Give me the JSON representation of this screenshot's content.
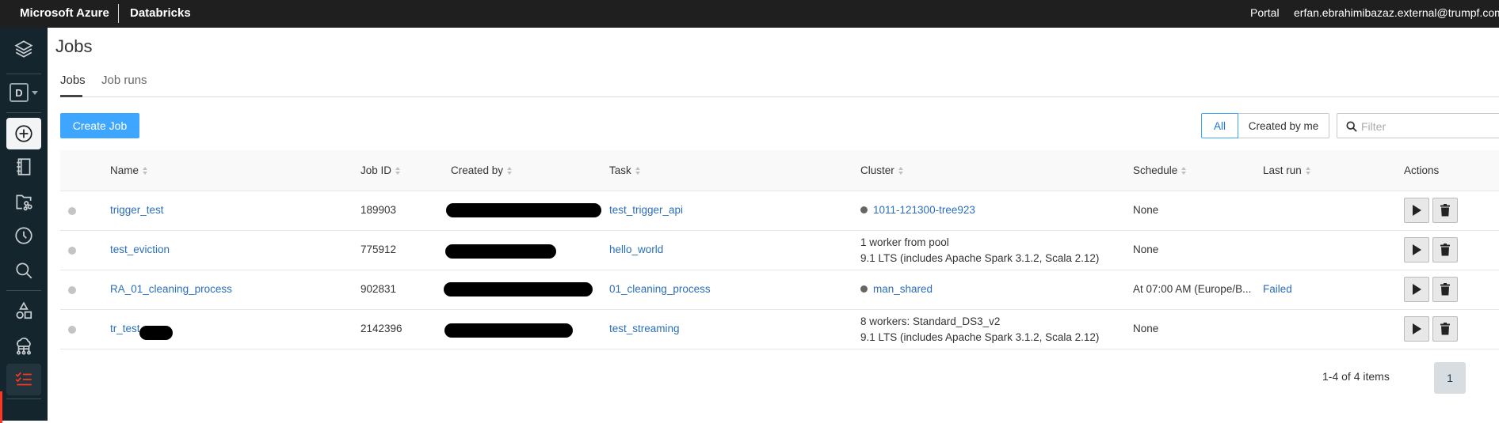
{
  "topbar": {
    "brand": "Microsoft Azure",
    "product": "Databricks",
    "portal": "Portal",
    "user": "erfan.ebrahimibazaz.external@trumpf.com"
  },
  "sidebar": {
    "workspace_letter": "D",
    "items": [
      {
        "name": "databricks-logo",
        "icon": "layers-icon"
      },
      {
        "name": "workspace-switcher",
        "icon": "d-box-icon"
      },
      {
        "name": "create",
        "icon": "plus-circle-icon"
      },
      {
        "name": "workspace",
        "icon": "notebook-icon"
      },
      {
        "name": "repos",
        "icon": "folder-branch-icon"
      },
      {
        "name": "recents",
        "icon": "clock-icon"
      },
      {
        "name": "search",
        "icon": "search-icon"
      },
      {
        "name": "data",
        "icon": "shapes-icon"
      },
      {
        "name": "compute",
        "icon": "cloud-network-icon"
      },
      {
        "name": "jobs",
        "icon": "checklist-icon",
        "active": true
      }
    ],
    "accent": "#ff3621"
  },
  "page": {
    "title": "Jobs",
    "tabs": [
      {
        "label": "Jobs",
        "active": true
      },
      {
        "label": "Job runs",
        "active": false
      }
    ]
  },
  "toolbar": {
    "create_label": "Create Job",
    "filter_all": "All",
    "filter_mine": "Created by me",
    "filter_placeholder": "Filter"
  },
  "table": {
    "columns": [
      "Name",
      "Job ID",
      "Created by",
      "Task",
      "Cluster",
      "Schedule",
      "Last run",
      "Actions"
    ],
    "rows": [
      {
        "name": "trigger_test",
        "job_id": "189903",
        "created_by": "[redacted]",
        "task": "test_trigger_api",
        "cluster_line1": "1011-121300-tree923",
        "cluster_line2": "",
        "cluster_link": true,
        "schedule": "None",
        "last_run": ""
      },
      {
        "name": "test_eviction",
        "job_id": "775912",
        "created_by": "[redacted]",
        "task": "hello_world",
        "cluster_line1": "1 worker from pool",
        "cluster_line2": "9.1 LTS (includes Apache Spark 3.1.2, Scala 2.12)",
        "cluster_link": false,
        "schedule": "None",
        "last_run": ""
      },
      {
        "name": "RA_01_cleaning_process",
        "job_id": "902831",
        "created_by": "[redacted]",
        "task": "01_cleaning_process",
        "cluster_line1": "man_shared",
        "cluster_line2": "",
        "cluster_link": true,
        "schedule": "At 07:00 AM (Europe/B...",
        "last_run": "Failed"
      },
      {
        "name": "tr_test",
        "job_id": "2142396",
        "created_by": "[redacted]",
        "task": "test_streaming",
        "cluster_line1": "8 workers: Standard_DS3_v2",
        "cluster_line2": "9.1 LTS (includes Apache Spark 3.1.2, Scala 2.12)",
        "cluster_link": false,
        "schedule": "None",
        "last_run": ""
      }
    ]
  },
  "pagination": {
    "summary": "1-4 of 4 items",
    "current_page": "1"
  },
  "colors": {
    "primary": "#3ea6ff",
    "link": "#2a6ebb",
    "topbar": "#1f1f1f",
    "sidebar": "#14252d"
  }
}
